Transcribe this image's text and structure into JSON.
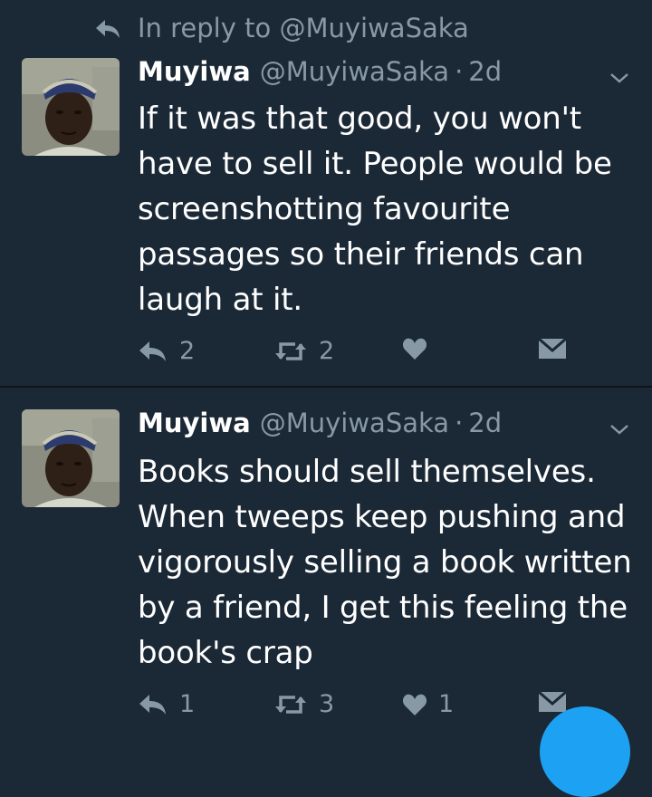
{
  "reply_context": {
    "text": "In reply to @MuyiwaSaka",
    "icon": "reply-arrow-icon"
  },
  "tweets": [
    {
      "name": "Muyiwa",
      "handle": "@MuyiwaSaka",
      "separator": "·",
      "time": "2d",
      "text": "If it was that good, you won't have to sell it. People would be screenshotting favourite passages so their friends can laugh at it.",
      "replies": "2",
      "retweets": "2",
      "likes": ""
    },
    {
      "name": "Muyiwa",
      "handle": "@MuyiwaSaka",
      "separator": "·",
      "time": "2d",
      "text": "Books should sell themselves. When tweeps keep pushing and vigorously selling a book written by a friend, I get this feeling the book's crap",
      "replies": "1",
      "retweets": "3",
      "likes": "1"
    }
  ],
  "colors": {
    "background": "#1b2836",
    "muted": "#8899a6",
    "text": "#ffffff",
    "accent": "#1da1f2"
  }
}
